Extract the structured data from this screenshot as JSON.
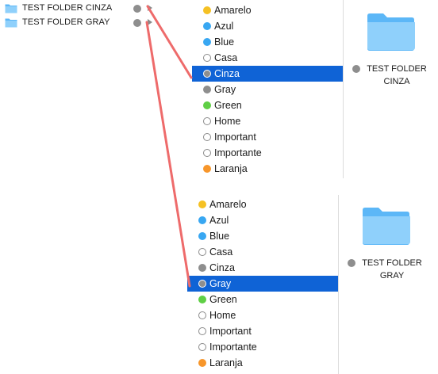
{
  "folders": [
    {
      "name": "TEST FOLDER CINZA",
      "tag_color": "#8e8e8e"
    },
    {
      "name": "TEST FOLDER GRAY",
      "tag_color": "#8e8e8e"
    }
  ],
  "panel1": {
    "tags": [
      {
        "label": "Amarelo",
        "color": "#f5c124",
        "hollow": false,
        "selected": false
      },
      {
        "label": "Azul",
        "color": "#38a7f2",
        "hollow": false,
        "selected": false
      },
      {
        "label": "Blue",
        "color": "#38a7f2",
        "hollow": false,
        "selected": false
      },
      {
        "label": "Casa",
        "color": "#ffffff",
        "hollow": true,
        "selected": false
      },
      {
        "label": "Cinza",
        "color": "#8e8e8e",
        "hollow": false,
        "selected": true
      },
      {
        "label": "Gray",
        "color": "#8e8e8e",
        "hollow": false,
        "selected": false
      },
      {
        "label": "Green",
        "color": "#5fcf45",
        "hollow": false,
        "selected": false
      },
      {
        "label": "Home",
        "color": "#ffffff",
        "hollow": true,
        "selected": false
      },
      {
        "label": "Important",
        "color": "#ffffff",
        "hollow": true,
        "selected": false
      },
      {
        "label": "Importante",
        "color": "#ffffff",
        "hollow": true,
        "selected": false
      },
      {
        "label": "Laranja",
        "color": "#f7962b",
        "hollow": false,
        "selected": false
      }
    ],
    "preview_line1": "TEST FOLDER",
    "preview_line2": "CINZA"
  },
  "panel2": {
    "tags": [
      {
        "label": "Amarelo",
        "color": "#f5c124",
        "hollow": false,
        "selected": false
      },
      {
        "label": "Azul",
        "color": "#38a7f2",
        "hollow": false,
        "selected": false
      },
      {
        "label": "Blue",
        "color": "#38a7f2",
        "hollow": false,
        "selected": false
      },
      {
        "label": "Casa",
        "color": "#ffffff",
        "hollow": true,
        "selected": false
      },
      {
        "label": "Cinza",
        "color": "#8e8e8e",
        "hollow": false,
        "selected": false
      },
      {
        "label": "Gray",
        "color": "#8e8e8e",
        "hollow": false,
        "selected": true
      },
      {
        "label": "Green",
        "color": "#5fcf45",
        "hollow": false,
        "selected": false
      },
      {
        "label": "Home",
        "color": "#ffffff",
        "hollow": true,
        "selected": false
      },
      {
        "label": "Important",
        "color": "#ffffff",
        "hollow": true,
        "selected": false
      },
      {
        "label": "Importante",
        "color": "#ffffff",
        "hollow": true,
        "selected": false
      },
      {
        "label": "Laranja",
        "color": "#f7962b",
        "hollow": false,
        "selected": false
      }
    ],
    "preview_line1": "TEST FOLDER",
    "preview_line2": "GRAY"
  },
  "colors": {
    "selection": "#0f63d6",
    "connector": "#ee6b6b",
    "folder_light": "#8fd0fb",
    "folder_dark": "#5cb7f7"
  },
  "icons": {
    "folder": "folder-icon",
    "disclosure": "disclosure-triangle-icon",
    "tag_dot": "tag-color-dot-icon"
  }
}
